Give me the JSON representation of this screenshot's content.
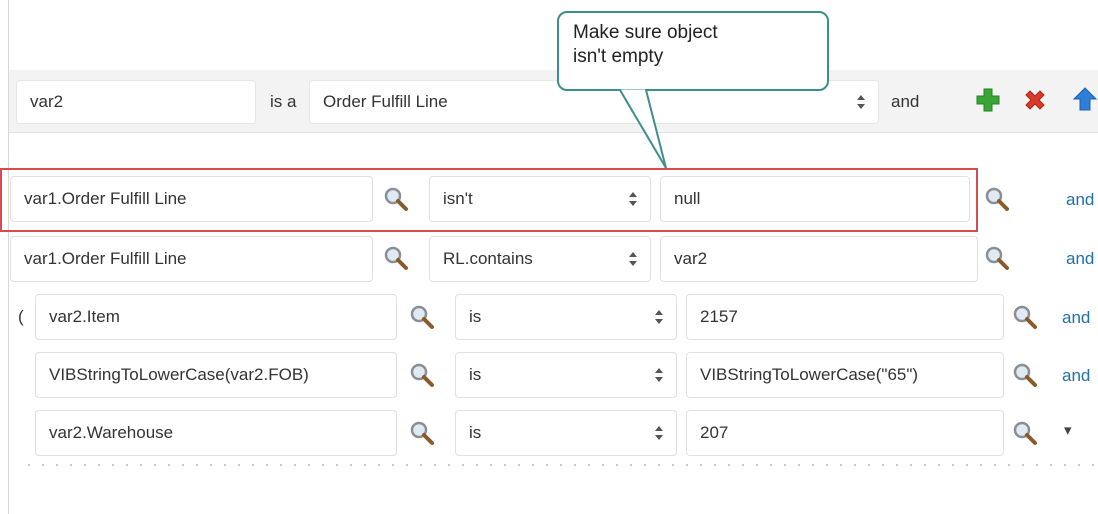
{
  "callout": {
    "line1": "Make sure object",
    "line2": "isn't empty"
  },
  "header": {
    "variable": "var2",
    "is_a_label": "is a",
    "type_value": "Order Fulfill Line",
    "and_label": "and",
    "add_icon": "add-icon",
    "delete_icon": "delete-icon",
    "up_icon": "up-arrow-icon",
    "colors": {
      "add": "#3aa537",
      "delete": "#d93a2b",
      "up": "#2f7fd8"
    }
  },
  "conditions": [
    {
      "open_paren": "",
      "left": "var1.Order Fulfill Line",
      "operator": "isn't",
      "right": "null",
      "conjunction": "and",
      "highlighted": true
    },
    {
      "open_paren": "",
      "left": "var1.Order Fulfill Line",
      "operator": "RL.contains",
      "right": "var2",
      "conjunction": "and",
      "highlighted": false
    },
    {
      "open_paren": "(",
      "left": "var2.Item",
      "operator": "is",
      "right": "2157",
      "conjunction": "and",
      "highlighted": false
    },
    {
      "open_paren": "",
      "left": "VIBStringToLowerCase(var2.FOB)",
      "operator": "is",
      "right": "VIBStringToLowerCase(\"65\")",
      "conjunction": "and",
      "highlighted": false
    },
    {
      "open_paren": "",
      "left": "var2.Warehouse",
      "operator": "is",
      "right": "207",
      "conjunction": "▾",
      "highlighted": false
    }
  ],
  "colors": {
    "highlight_border": "#d94a4a",
    "callout_border": "#3c8f8c",
    "link": "#1f6fa8"
  }
}
